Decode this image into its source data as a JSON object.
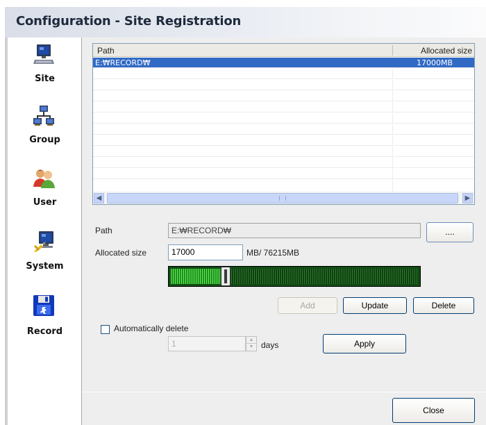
{
  "window": {
    "title": "Configuration - Site Registration"
  },
  "sidebar": {
    "items": [
      {
        "label": "Site",
        "icon": "computer-icon"
      },
      {
        "label": "Group",
        "icon": "network-icon"
      },
      {
        "label": "User",
        "icon": "users-icon"
      },
      {
        "label": "System",
        "icon": "system-tools-icon"
      },
      {
        "label": "Record",
        "icon": "floppy-disk-icon"
      }
    ]
  },
  "list": {
    "columns": [
      "Path",
      "Allocated size"
    ],
    "rows": [
      {
        "path": "E:₩RECORD₩",
        "size": "17000MB"
      }
    ]
  },
  "form": {
    "path_label": "Path",
    "path_value": "E:₩RECORD₩",
    "browse_label": "....",
    "size_label": "Allocated size",
    "size_value": "17000",
    "size_unit": "MB/ 76215MB",
    "slider_fraction": 0.223,
    "add_label": "Add",
    "update_label": "Update",
    "delete_label": "Delete",
    "auto_delete_label": "Automatically delete",
    "auto_delete_checked": false,
    "days_value": "1",
    "days_label": "days",
    "apply_label": "Apply"
  },
  "footer": {
    "close_label": "Close"
  },
  "colors": {
    "selection": "#316ac5",
    "slider_fill": "#1a8f1a",
    "slider_track": "#0f3f10"
  }
}
